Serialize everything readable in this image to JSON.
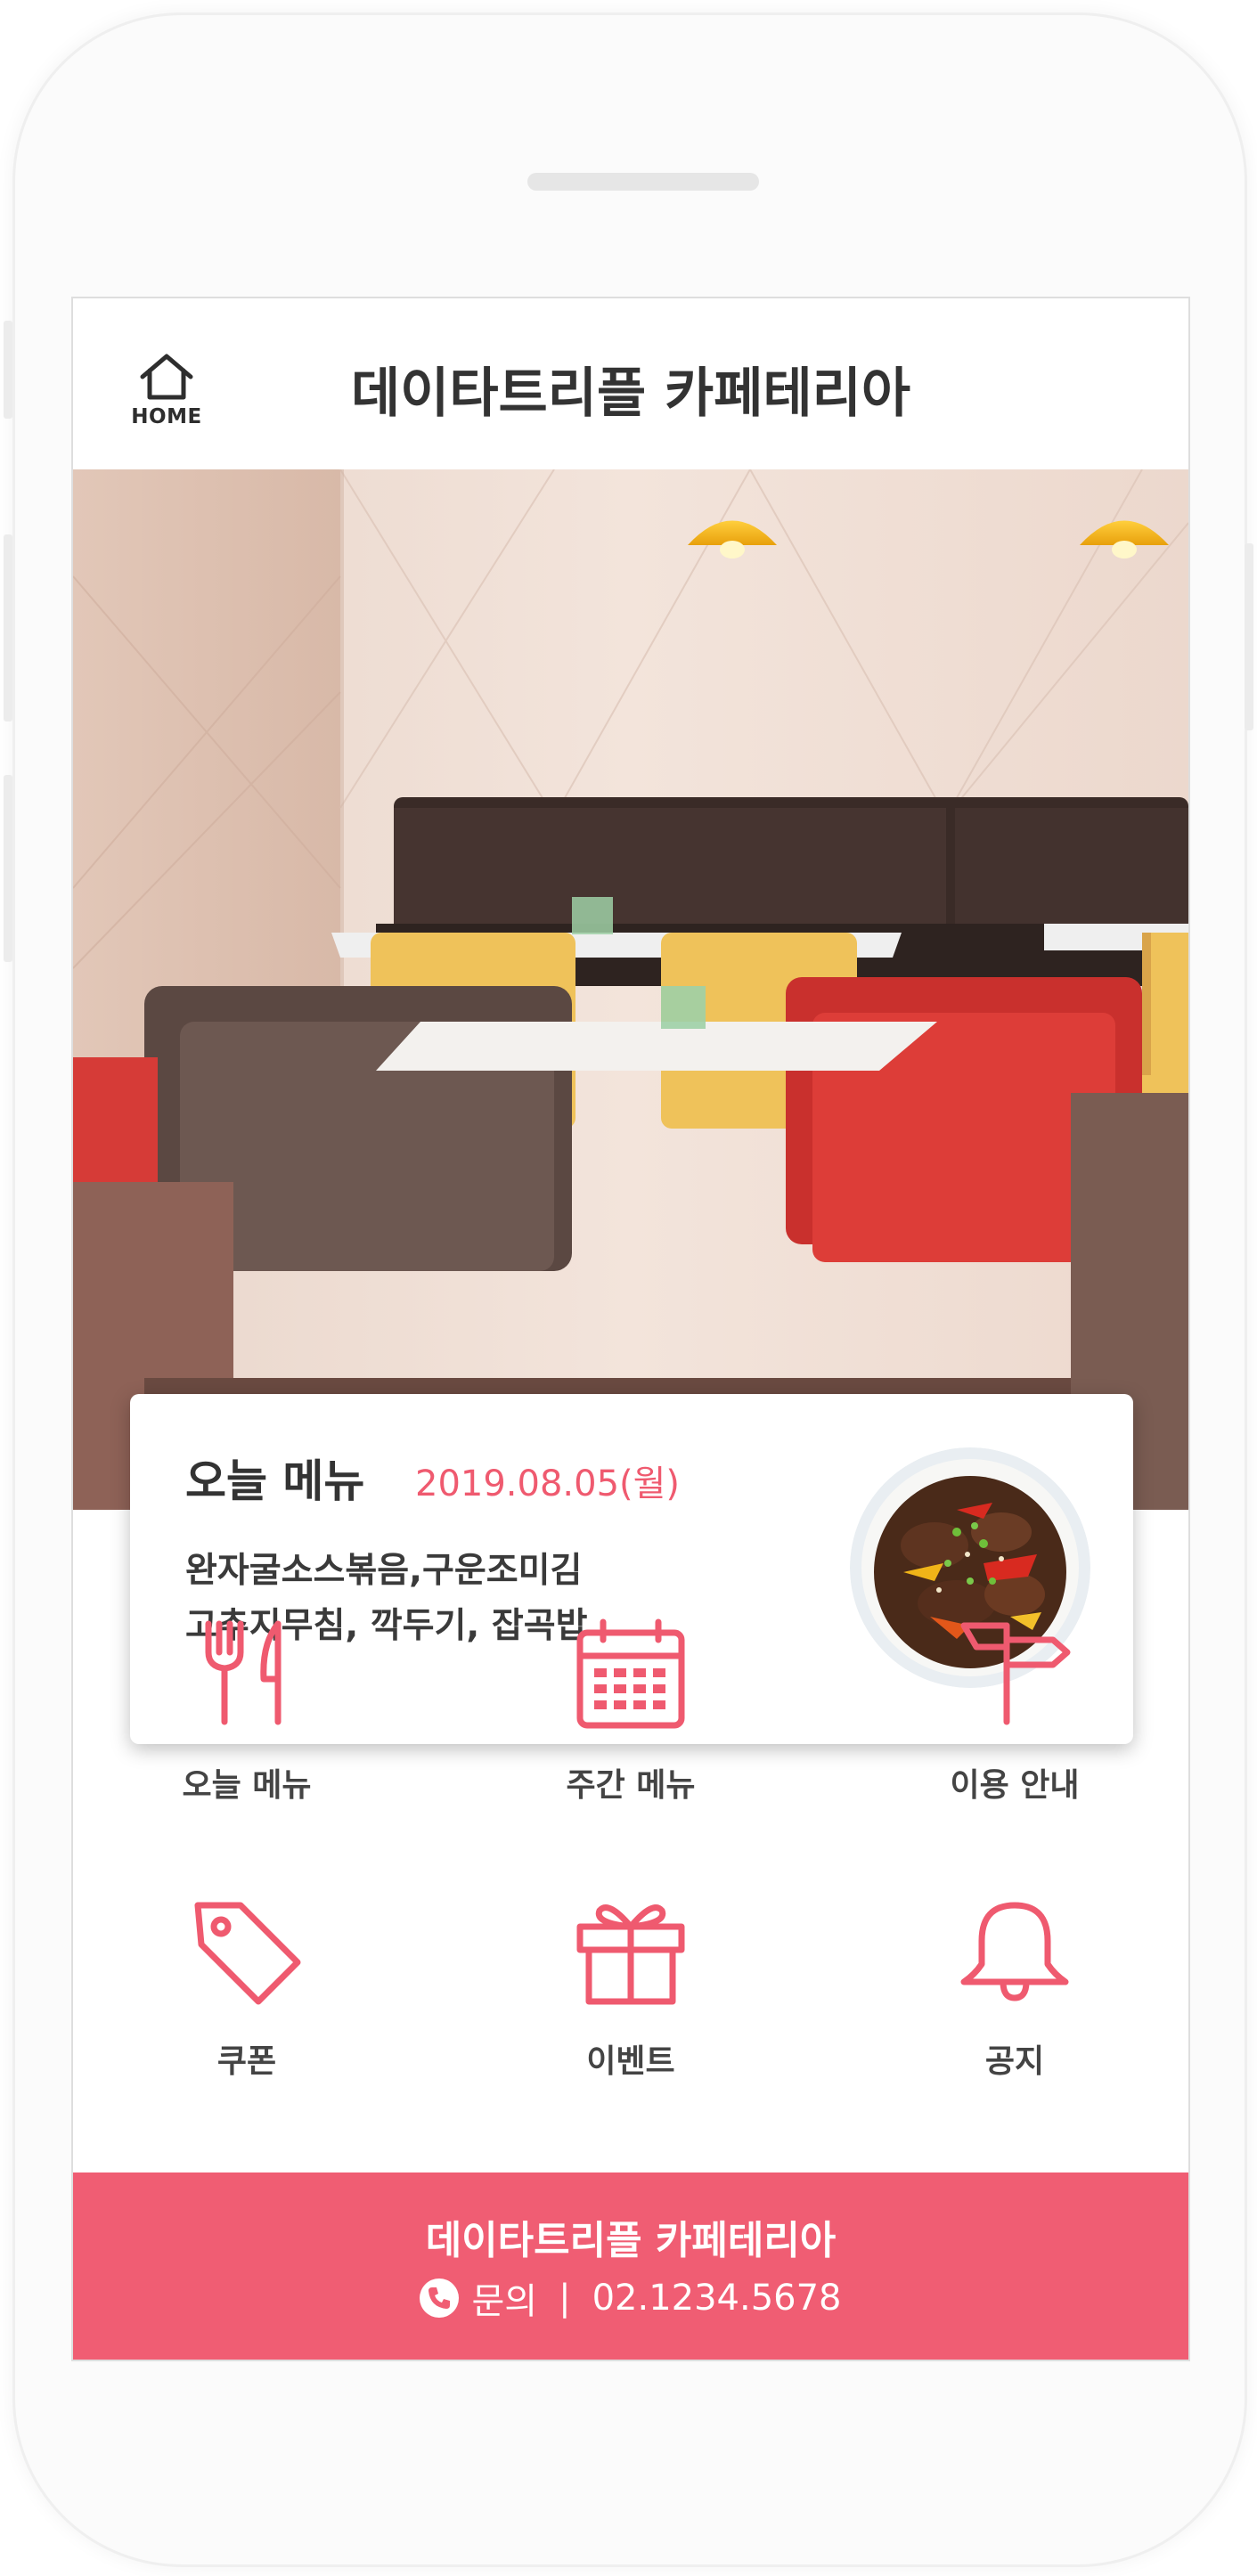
{
  "header": {
    "home_label": "HOME",
    "title": "데이타트리플 카페테리아"
  },
  "today_menu": {
    "title": "오늘 메뉴",
    "date": "2019.08.05(월)",
    "items": [
      "완자굴소스볶음,구운조미김",
      "고추지무침, 깍두기, 잡곡밥"
    ]
  },
  "quick_menu": [
    {
      "label": "오늘 메뉴",
      "icon": "fork-knife-icon"
    },
    {
      "label": "주간 메뉴",
      "icon": "calendar-icon"
    },
    {
      "label": "이용 안내",
      "icon": "signpost-icon"
    },
    {
      "label": "쿠폰",
      "icon": "tag-icon"
    },
    {
      "label": "이벤트",
      "icon": "gift-icon"
    },
    {
      "label": "공지",
      "icon": "bell-icon"
    }
  ],
  "footer": {
    "title": "데이타트리플 카페테리아",
    "contact_label": "문의",
    "separator": "|",
    "phone": "02.1234.5678"
  },
  "colors": {
    "accent": "#ef5a6f",
    "footer_bg": "#f05d73",
    "text_dark": "#333333"
  }
}
